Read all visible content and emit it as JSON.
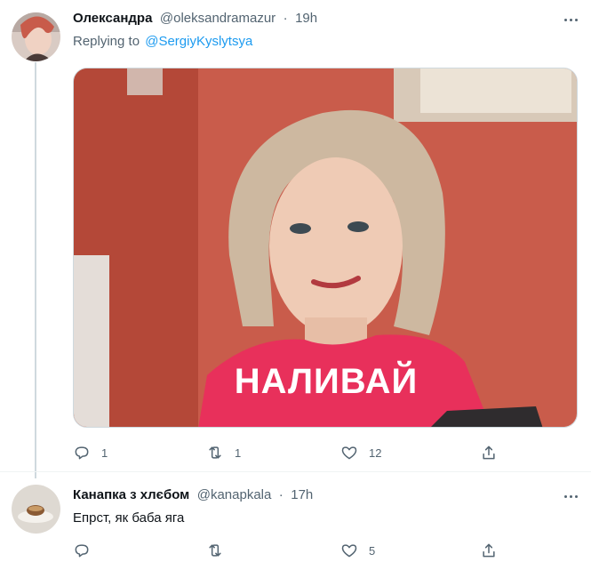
{
  "tweet1": {
    "author_name": "Олександра",
    "handle": "@oleksandramazur",
    "separator": "·",
    "time": "19h",
    "replying_prefix": "Replying to",
    "replying_to": "@SergiyKyslytsya",
    "image_caption": "НАЛИВАЙ",
    "actions": {
      "replies": "1",
      "retweets": "1",
      "likes": "12",
      "share": ""
    }
  },
  "tweet2": {
    "author_name": "Канапка з хлєбом",
    "handle": "@kanapkala",
    "separator": "·",
    "time": "17h",
    "text": "Епрст, як баба яга",
    "actions": {
      "replies": "",
      "retweets": "",
      "likes": "5",
      "share": ""
    }
  },
  "colors": {
    "accent": "#1d9bf0",
    "muted": "#536471",
    "text": "#0f1419",
    "border": "#cfd9de"
  },
  "icons": [
    "reply-icon",
    "retweet-icon",
    "like-icon",
    "share-icon",
    "more-icon"
  ]
}
